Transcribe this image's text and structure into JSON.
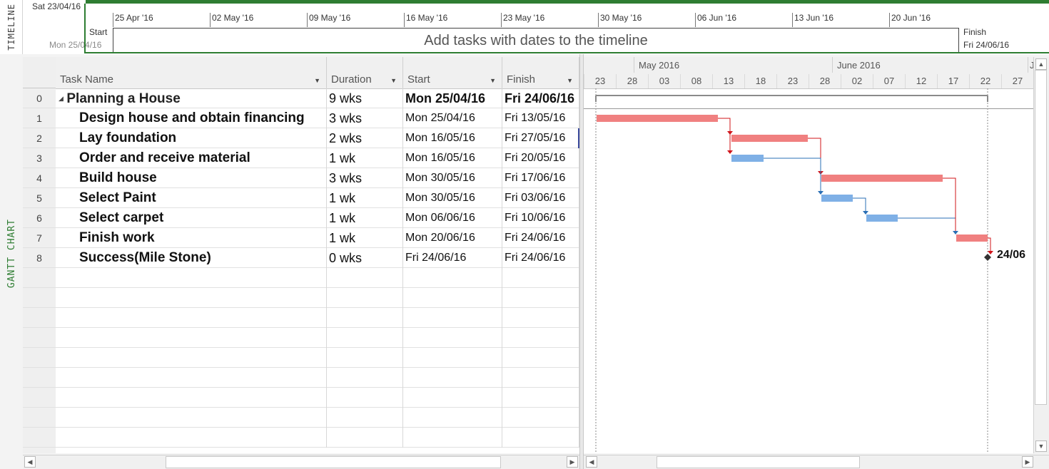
{
  "timeline": {
    "side_label": "TIMELINE",
    "current_date": "Sat 23/04/16",
    "start_label": "Start",
    "start_date": "Mon 25/04/16",
    "finish_label": "Finish",
    "finish_date": "Fri 24/06/16",
    "placeholder": "Add tasks with dates to the timeline",
    "scale": [
      "25 Apr '16",
      "02 May '16",
      "09 May '16",
      "16 May '16",
      "23 May '16",
      "30 May '16",
      "06 Jun '16",
      "13 Jun '16",
      "20 Jun '16"
    ]
  },
  "view": {
    "side_label": "GANTT CHART"
  },
  "table": {
    "columns": {
      "task_name": "Task Name",
      "duration": "Duration",
      "start": "Start",
      "finish": "Finish"
    },
    "rows": [
      {
        "id": "0",
        "name": "Planning a House",
        "duration": "9 wks",
        "start": "Mon 25/04/16",
        "finish": "Fri 24/06/16",
        "summary": true,
        "collapse_glyph": "◢"
      },
      {
        "id": "1",
        "name": "Design house and obtain financing",
        "duration": "3 wks",
        "start": "Mon 25/04/16",
        "finish": "Fri 13/05/16"
      },
      {
        "id": "2",
        "name": "Lay foundation",
        "duration": "2 wks",
        "start": "Mon 16/05/16",
        "finish": "Fri 27/05/16"
      },
      {
        "id": "3",
        "name": "Order and receive material",
        "duration": "1 wk",
        "start": "Mon 16/05/16",
        "finish": "Fri 20/05/16"
      },
      {
        "id": "4",
        "name": "Build house",
        "duration": "3 wks",
        "start": "Mon 30/05/16",
        "finish": "Fri 17/06/16"
      },
      {
        "id": "5",
        "name": "Select Paint",
        "duration": "1 wk",
        "start": "Mon 30/05/16",
        "finish": "Fri 03/06/16"
      },
      {
        "id": "6",
        "name": "Select carpet",
        "duration": "1 wk",
        "start": "Mon 06/06/16",
        "finish": "Fri 10/06/16"
      },
      {
        "id": "7",
        "name": "Finish work",
        "duration": "1 wk",
        "start": "Mon 20/06/16",
        "finish": "Fri 24/06/16"
      },
      {
        "id": "8",
        "name": "Success(Mile Stone)",
        "duration": "0 wks",
        "start": "Fri 24/06/16",
        "finish": "Fri 24/06/16"
      }
    ]
  },
  "gantt": {
    "months": [
      "May 2016",
      "June 2016",
      "J"
    ],
    "days": [
      "23",
      "28",
      "03",
      "08",
      "13",
      "18",
      "23",
      "28",
      "02",
      "07",
      "12",
      "17",
      "22",
      "27"
    ],
    "milestone_label": "24/06",
    "colors": {
      "critical": "#f08080",
      "normal": "#7fb0e6",
      "critical_link": "#d0141a",
      "normal_link": "#2a6fb5",
      "accent": "#2e7d32"
    }
  }
}
